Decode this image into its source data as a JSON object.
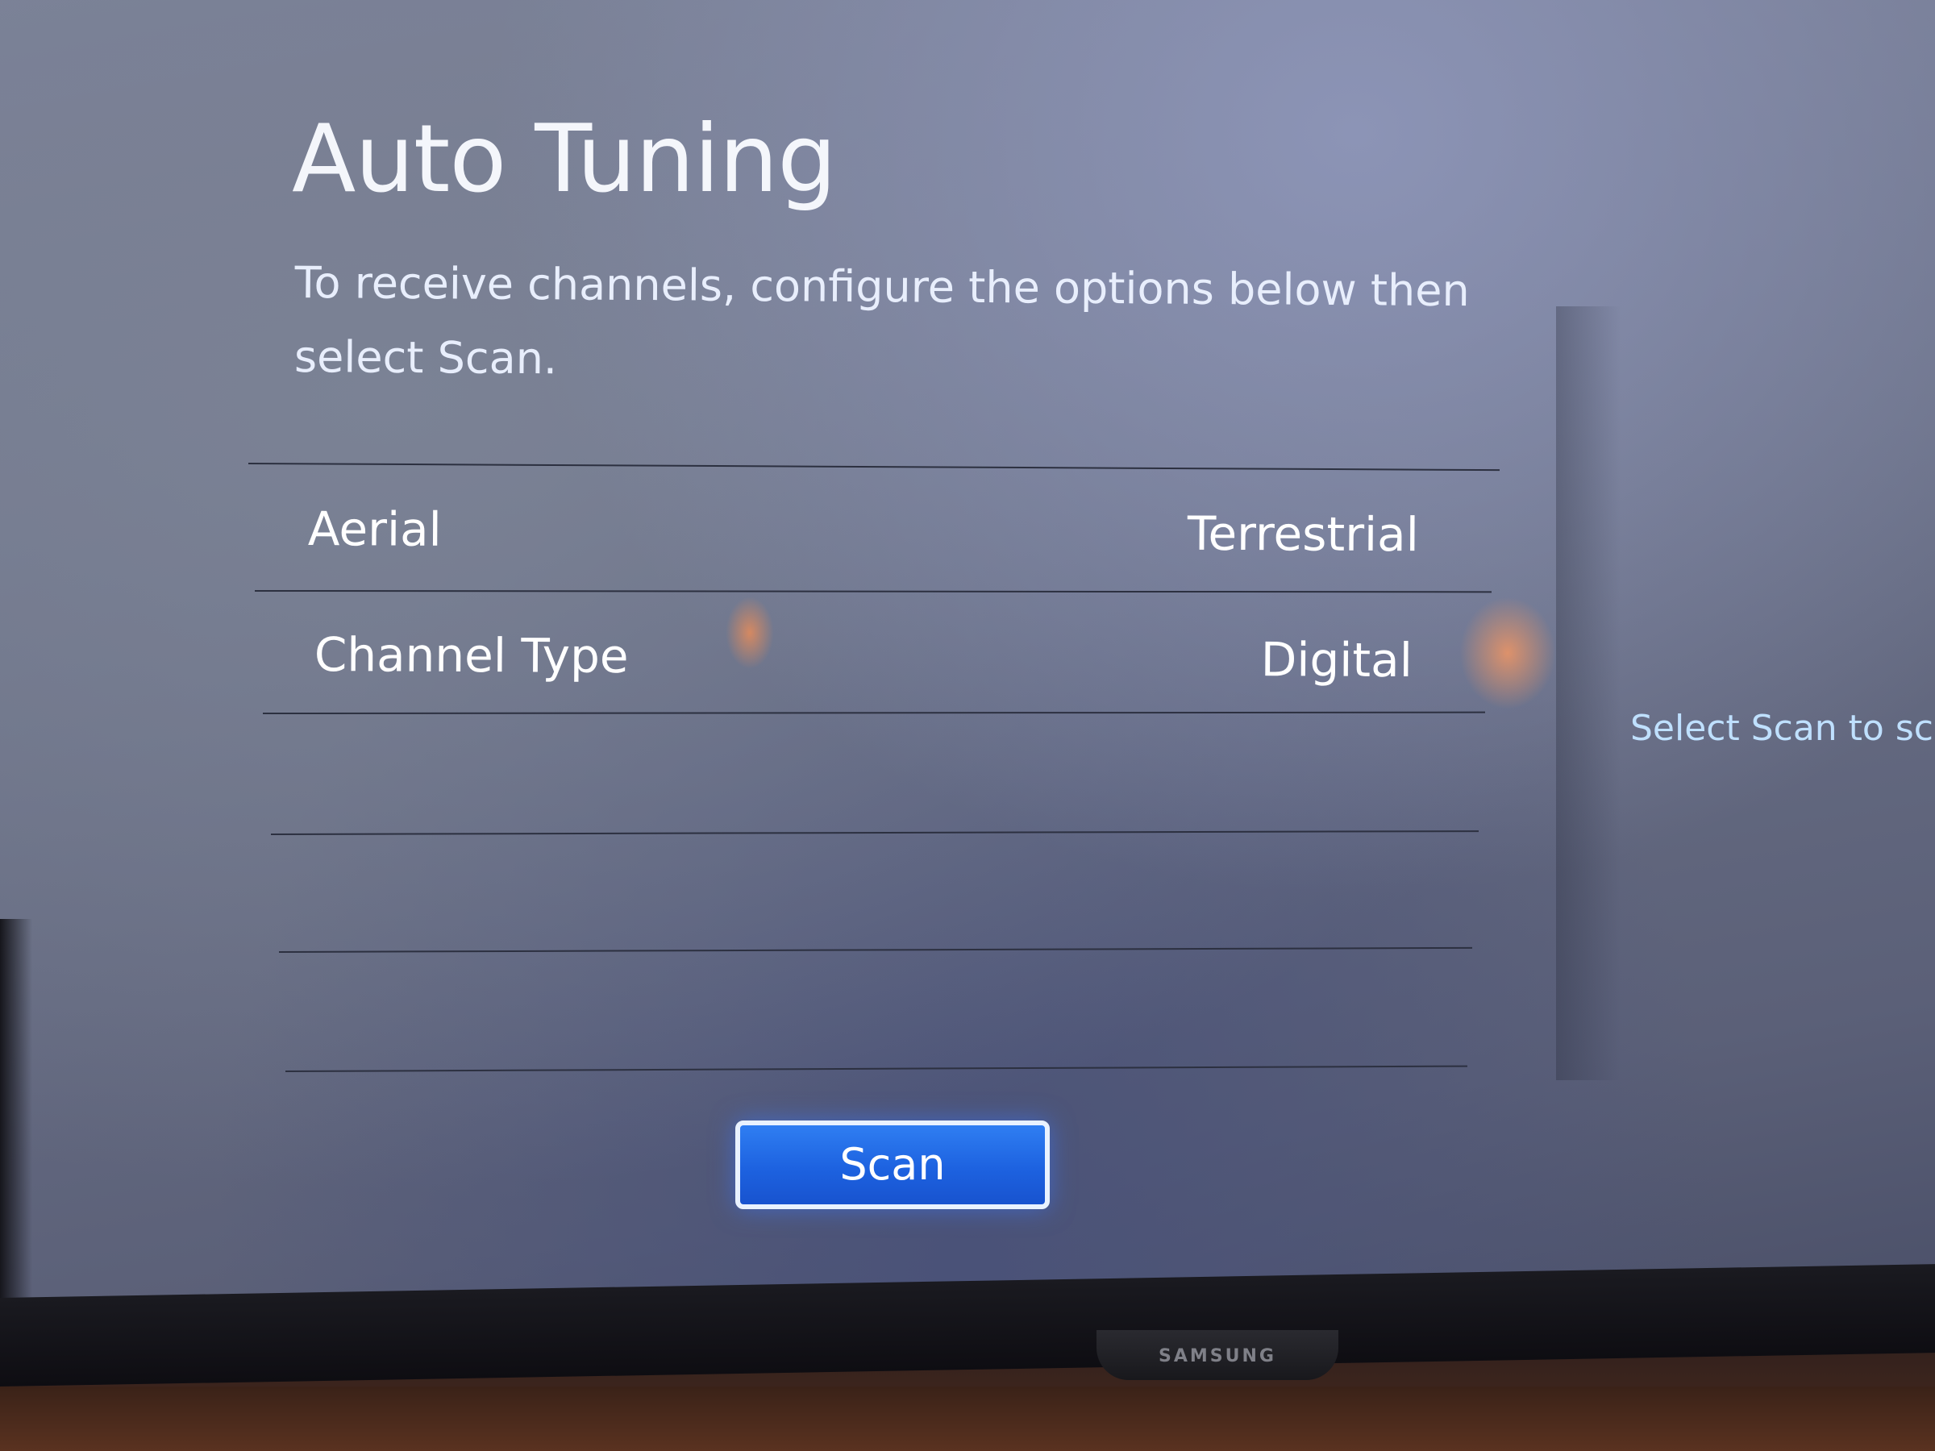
{
  "screen": {
    "title": "Auto Tuning",
    "instructions": "To receive channels, configure the options below then select Scan.",
    "settings": [
      {
        "label": "Aerial",
        "value": "Terrestrial"
      },
      {
        "label": "Channel Type",
        "value": "Digital"
      }
    ],
    "scan_button_label": "Scan",
    "side_hint": "Select Scan to scan"
  },
  "tv": {
    "brand": "SAMSUNG"
  },
  "colors": {
    "scan_button": "#1d62e0",
    "scan_button_border": "#e9f2ff",
    "hint_text": "#bfe0ff",
    "background": "#6a7086"
  }
}
